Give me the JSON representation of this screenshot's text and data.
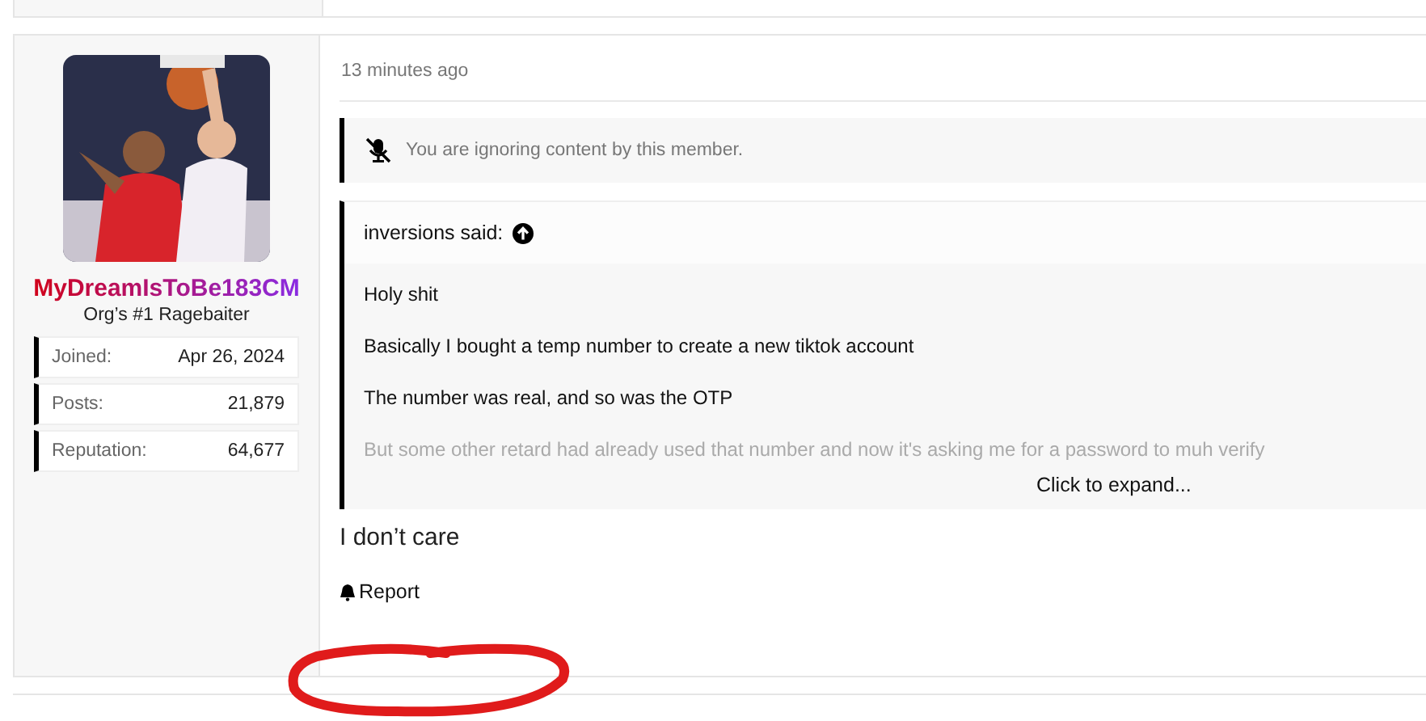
{
  "user": {
    "name": "MyDreamIsToBe183CM",
    "title": "Org’s #1 Ragebaiter",
    "stats": [
      {
        "label": "Joined:",
        "value": "Apr 26, 2024"
      },
      {
        "label": "Posts:",
        "value": "21,879"
      },
      {
        "label": "Reputation:",
        "value": "64,677"
      }
    ]
  },
  "post": {
    "time": "13 minutes ago",
    "ignored_notice": "You are ignoring content by this member.",
    "quote": {
      "author": "inversions said:",
      "lines": [
        "Holy shit",
        "Basically I bought a temp number to create a new tiktok account",
        "The number was real, and so was the OTP",
        "But some other retard had already used that number and now it's asking me for a password to muh verify"
      ],
      "expand": "Click to expand..."
    },
    "body": "I don’t care",
    "actions": [
      "Report"
    ]
  }
}
